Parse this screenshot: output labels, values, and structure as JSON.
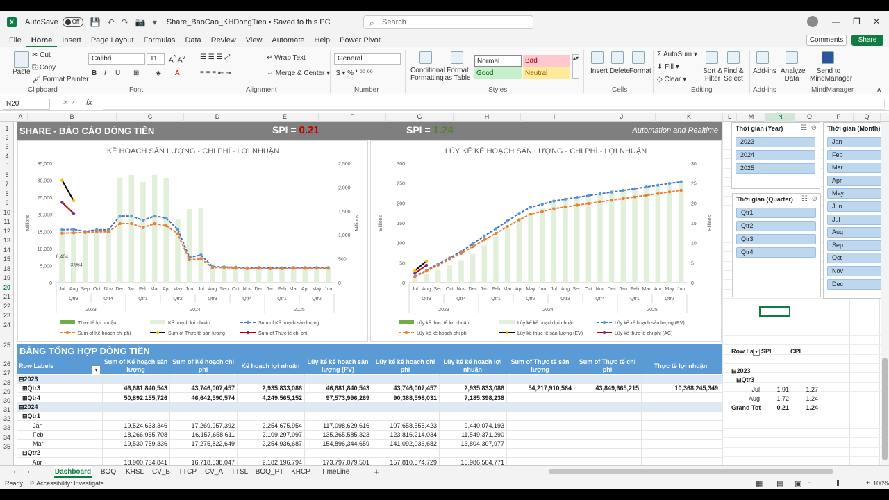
{
  "titlebar": {
    "autosave_label": "AutoSave",
    "autosave_state": "Off",
    "filename": "Share_BaoCao_KHDongTien • Saved to this PC",
    "search_placeholder": "Search"
  },
  "menu": [
    "File",
    "Home",
    "Insert",
    "Page Layout",
    "Formulas",
    "Data",
    "Review",
    "View",
    "Automate",
    "Help",
    "Power Pivot"
  ],
  "menu_active": "Home",
  "comments_label": "Comments",
  "share_label": "Share",
  "ribbon": {
    "clipboard": {
      "paste": "Paste",
      "cut": "Cut",
      "copy": "Copy",
      "format_painter": "Format Painter",
      "group": "Clipboard"
    },
    "font": {
      "name": "Calibri",
      "size": "11",
      "group": "Font"
    },
    "alignment": {
      "wrap": "Wrap Text",
      "merge": "Merge & Center",
      "group": "Alignment"
    },
    "number": {
      "format": "General",
      "group": "Number"
    },
    "styles": {
      "cond": "Conditional Formatting",
      "table": "Format as Table",
      "normal": "Normal",
      "bad": "Bad",
      "good": "Good",
      "neutral": "Neutral",
      "group": "Styles"
    },
    "cells": {
      "insert": "Insert",
      "delete": "Delete",
      "format": "Format",
      "group": "Cells"
    },
    "editing": {
      "autosum": "AutoSum",
      "fill": "Fill",
      "clear": "Clear",
      "sort": "Sort & Filter",
      "find": "Find & Select",
      "group": "Editing"
    },
    "addins": {
      "label": "Add-ins",
      "group": "Add-ins"
    },
    "analyze": "Analyze Data",
    "mindmanager": {
      "label": "Send to MindManager",
      "group": "MindManager"
    }
  },
  "formula_bar": {
    "name_box": "N20",
    "fx": "fx",
    "content": ""
  },
  "columns": [
    "A",
    "B",
    "C",
    "D",
    "E",
    "F",
    "G",
    "H",
    "I",
    "J",
    "K",
    "L",
    "M",
    "N",
    "O",
    "P",
    "Q"
  ],
  "rows": [
    "1",
    "2",
    "3",
    "4",
    "5",
    "6",
    "7",
    "8",
    "9",
    "10",
    "11",
    "12",
    "13",
    "14",
    "15",
    "18",
    "19",
    "20",
    "21",
    "22",
    "23",
    "24",
    "25",
    "26",
    "27",
    "28",
    "29",
    "30",
    "31",
    "32",
    "33",
    "34",
    "35"
  ],
  "banner": {
    "title": "SHARE - BÁO CÁO DÒNG TIỀN",
    "spi1_label": "SPI =",
    "spi1_value": "0.21",
    "spi2_label": "SPI =",
    "spi2_value": "1.24",
    "tagline": "Automation and Realtime"
  },
  "colors": {
    "bad": "#c00000",
    "good": "#548235",
    "header_blue": "#5b9bd5",
    "bar_green": "#70ad47",
    "bar_light": "#e2efda",
    "plan_line": "#4472c4",
    "cost_line": "#ed7d31",
    "actual_line": "#ffc000"
  },
  "chart_data": [
    {
      "type": "bar",
      "title": "KẾ HOẠCH SẢN LƯỢNG - CHI PHÍ - LỢI NHUẬN",
      "ylabel": "Millions",
      "y2label": "Millions",
      "ylim": [
        0,
        35000
      ],
      "y2lim": [
        0,
        2500
      ],
      "yticks": [
        "0",
        "5,000",
        "10,000",
        "15,000",
        "20,000",
        "25,000",
        "30,000",
        "35,000"
      ],
      "y2ticks": [
        "0",
        "500",
        "1,000",
        "1,500",
        "2,000",
        "2,500"
      ],
      "categories": [
        "Jul",
        "Aug",
        "Sep",
        "Oct",
        "Nov",
        "Dec",
        "Jan",
        "Feb",
        "Mar",
        "Apr",
        "May",
        "Jun",
        "Jul",
        "Aug",
        "Sep",
        "Oct",
        "Nov",
        "Dec",
        "Jan",
        "Feb",
        "Mar",
        "Apr",
        "May",
        "Jun"
      ],
      "quarters": [
        "Qtr3",
        "Qtr4",
        "Qtr1",
        "Qtr2",
        "Qtr3",
        "Qtr4",
        "Qtr1",
        "Qtr2"
      ],
      "years": [
        "2023",
        "2024",
        "2025"
      ],
      "data_labels": [
        "6,404",
        "3,964"
      ],
      "series": [
        {
          "name": "Thực tế lợi nhuận",
          "kind": "bar",
          "axis": "y",
          "values": [
            6404,
            3964,
            null,
            null,
            null,
            null,
            null,
            null,
            null,
            null,
            null,
            null,
            null,
            null,
            null,
            null,
            null,
            null,
            null,
            null,
            null,
            null,
            null,
            null
          ]
        },
        {
          "name": "Kế hoạch lợi nhuận",
          "kind": "bar",
          "axis": "y2",
          "values": [
            1080,
            1080,
            1040,
            1110,
            1120,
            2190,
            2254,
            2109,
            2254,
            2182,
            1320,
            1540,
            1570,
            400,
            340,
            330,
            340,
            330,
            320,
            320,
            330,
            330,
            330,
            320
          ]
        },
        {
          "name": "Sum of Kế hoạch sản lượng",
          "kind": "line",
          "axis": "y",
          "values": [
            15500,
            15600,
            15000,
            15500,
            15500,
            19500,
            19524,
            18267,
            19531,
            18900,
            15600,
            7400,
            8100,
            4700,
            4600,
            4500,
            4300,
            4400,
            4300,
            4300,
            4400,
            4400,
            4400,
            4400
          ]
        },
        {
          "name": "Sum of Kế hoạch chi phí",
          "kind": "line",
          "axis": "y",
          "values": [
            14500,
            14600,
            14700,
            14900,
            14900,
            17300,
            17270,
            16158,
            17276,
            16700,
            14300,
            6700,
            7000,
            4400,
            4400,
            4200,
            4100,
            4200,
            4100,
            4100,
            4200,
            4200,
            4200,
            4200
          ]
        },
        {
          "name": "Sum of Thực tế sản lượng",
          "kind": "line",
          "axis": "y",
          "values": [
            30000,
            24000,
            null,
            null,
            null,
            null,
            null,
            null,
            null,
            null,
            null,
            null,
            null,
            null,
            null,
            null,
            null,
            null,
            null,
            null,
            null,
            null,
            null,
            null
          ]
        },
        {
          "name": "Sum of Thực tế chi phí",
          "kind": "line",
          "axis": "y",
          "values": [
            23500,
            20300,
            null,
            null,
            null,
            null,
            null,
            null,
            null,
            null,
            null,
            null,
            null,
            null,
            null,
            null,
            null,
            null,
            null,
            null,
            null,
            null,
            null,
            null
          ]
        }
      ]
    },
    {
      "type": "bar",
      "title": "LŨY KẾ KẾ HOẠCH SẢN LƯỢNG - CHI PHÍ - LỢI NHUẬN",
      "ylabel": "Billions",
      "y2label": "Billions",
      "ylim": [
        0,
        300
      ],
      "y2lim": [
        0,
        30
      ],
      "yticks": [
        "0",
        "50",
        "100",
        "150",
        "200",
        "250",
        "300"
      ],
      "y2ticks": [
        "0",
        "5",
        "10",
        "15",
        "20",
        "25",
        "30"
      ],
      "categories": [
        "Jul",
        "Aug",
        "Sep",
        "Oct",
        "Nov",
        "Dec",
        "Jan",
        "Feb",
        "Mar",
        "Apr",
        "May",
        "Jun",
        "Jul",
        "Aug",
        "Sep",
        "Oct",
        "Nov",
        "Dec",
        "Jan",
        "Feb",
        "Mar",
        "Apr",
        "May",
        "Jun"
      ],
      "quarters": [
        "Qtr3",
        "Qtr4",
        "Qtr1",
        "Qtr2",
        "Qtr3",
        "Qtr4",
        "Qtr1",
        "Qtr2"
      ],
      "years": [
        "2023",
        "2024",
        "2025"
      ],
      "series": [
        {
          "name": "Lũy kế thực tế lợi nhuận",
          "kind": "bar",
          "axis": "y2",
          "values": [
            0.6,
            1.0,
            null,
            null,
            null,
            null,
            null,
            null,
            null,
            null,
            null,
            null,
            null,
            null,
            null,
            null,
            null,
            null,
            null,
            null,
            null,
            null,
            null,
            null
          ]
        },
        {
          "name": "Lũy kế kế hoạch lợi nhuận",
          "kind": "bar",
          "axis": "y2",
          "values": [
            1.1,
            2.2,
            3.2,
            4.3,
            5.5,
            7.2,
            9.4,
            11.5,
            13.8,
            16.0,
            17.3,
            18.8,
            20.4,
            21.0,
            21.4,
            21.8,
            22.2,
            22.6,
            23.0,
            23.4,
            23.8,
            24.2,
            24.6,
            25.0
          ]
        },
        {
          "name": "Lũy kế kế hoạch sản lượng (PV)",
          "kind": "line",
          "axis": "y",
          "values": [
            15.6,
            31.1,
            46.7,
            62.2,
            77.7,
            97.6,
            117.1,
            135.4,
            154.9,
            173.8,
            189.4,
            196.8,
            204.9,
            209.6,
            214.2,
            218.7,
            223.0,
            227.4,
            231.7,
            236.0,
            240.4,
            244.8,
            249.2,
            253.6
          ]
        },
        {
          "name": "Lũy kế kế hoạch chi phí",
          "kind": "line",
          "axis": "y",
          "values": [
            14.6,
            29.2,
            43.7,
            58.6,
            73.5,
            90.4,
            107.7,
            123.8,
            141.1,
            157.8,
            172.1,
            178.8,
            185.8,
            190.2,
            194.6,
            198.8,
            202.9,
            207.1,
            211.2,
            215.3,
            219.5,
            223.7,
            227.9,
            232.1
          ]
        },
        {
          "name": "Lũy kế thực tế sản lượng (EV)",
          "kind": "line",
          "axis": "y",
          "values": [
            30.0,
            54.2,
            null,
            null,
            null,
            null,
            null,
            null,
            null,
            null,
            null,
            null,
            null,
            null,
            null,
            null,
            null,
            null,
            null,
            null,
            null,
            null,
            null,
            null
          ]
        },
        {
          "name": "Lũy kế thực tế chi phí (AC)",
          "kind": "line",
          "axis": "y",
          "values": [
            23.5,
            43.8,
            null,
            null,
            null,
            null,
            null,
            null,
            null,
            null,
            null,
            null,
            null,
            null,
            null,
            null,
            null,
            null,
            null,
            null,
            null,
            null,
            null,
            null
          ]
        }
      ]
    }
  ],
  "slicers": {
    "year": {
      "title": "Thời gian (Year)",
      "items": [
        "2023",
        "2024",
        "2025"
      ]
    },
    "quarter": {
      "title": "Thời gian (Quarter)",
      "items": [
        "Qtr1",
        "Qtr2",
        "Qtr3",
        "Qtr4"
      ]
    },
    "month": {
      "title": "Thời gian (Month)",
      "items": [
        "Jan",
        "Feb",
        "Mar",
        "Apr",
        "May",
        "Jun",
        "Jul",
        "Aug",
        "Sep",
        "Oct",
        "Nov",
        "Dec"
      ]
    }
  },
  "pivot": {
    "title": "BẢNG TỔNG HỢP DÒNG TIỀN",
    "headers": [
      "Row Labels",
      "Sum of Kế hoạch sản lượng",
      "Sum of Kế hoạch chi phí",
      "Kế hoạch lợi nhuận",
      "Lũy kế kế hoạch sản lượng (PV)",
      "Lũy kế kế hoạch chi phí",
      "Lũy kế kế hoạch lợi nhuận",
      "Sum of Thực tế sản lượng",
      "Sum of Thực tế chi phí",
      "Thực tế lợi nhuận"
    ],
    "rows": [
      {
        "label": "⊟2023",
        "cls": "yr",
        "cells": [
          "",
          "",
          "",
          "",
          "",
          "",
          "",
          "",
          ""
        ]
      },
      {
        "label": "  ⊞Qtr3",
        "cls": "bold",
        "cells": [
          "46,681,840,543",
          "43,746,007,457",
          "2,935,833,086",
          "46,681,840,543",
          "43,746,007,457",
          "2,935,833,086",
          "54,217,910,564",
          "43,849,665,215",
          "10,368,245,349"
        ]
      },
      {
        "label": "  ⊞Qtr4",
        "cls": "bold",
        "cells": [
          "50,892,155,726",
          "46,642,590,574",
          "4,249,565,152",
          "97,573,996,269",
          "90,388,598,031",
          "7,185,398,238",
          "",
          "",
          ""
        ]
      },
      {
        "label": "⊟2024",
        "cls": "yr",
        "cells": [
          "",
          "",
          "",
          "",
          "",
          "",
          "",
          "",
          ""
        ]
      },
      {
        "label": "  ⊟Qtr1",
        "cls": "bold",
        "cells": [
          "",
          "",
          "",
          "",
          "",
          "",
          "",
          "",
          ""
        ]
      },
      {
        "label": "        Jan",
        "cls": "",
        "cells": [
          "19,524,633,346",
          "17,269,957,392",
          "2,254,675,954",
          "117,098,629,616",
          "107,658,555,423",
          "9,440,074,193",
          "",
          "",
          ""
        ]
      },
      {
        "label": "        Feb",
        "cls": "",
        "cells": [
          "18,266,955,708",
          "16,157,658,611",
          "2,109,297,097",
          "135,365,585,323",
          "123,816,214,034",
          "11,549,371,290",
          "",
          "",
          ""
        ]
      },
      {
        "label": "        Mar",
        "cls": "",
        "cells": [
          "19,530,759,336",
          "17,275,822,649",
          "2,254,936,687",
          "154,896,344,659",
          "141,092,036,682",
          "13,804,307,977",
          "",
          "",
          ""
        ]
      },
      {
        "label": "  ⊟Qtr2",
        "cls": "bold",
        "cells": [
          "",
          "",
          "",
          "",
          "",
          "",
          "",
          "",
          ""
        ]
      },
      {
        "label": "        Apr",
        "cls": "",
        "cells": [
          "18,900,734,841",
          "16,718,538,047",
          "2,182,196,794",
          "173,797,079,501",
          "157,810,574,729",
          "15,986,504,771",
          "",
          "",
          ""
        ]
      }
    ]
  },
  "small_pivot": {
    "headers": [
      "Row La",
      "SPI",
      "CPI"
    ],
    "rows": [
      {
        "label": "⊟2023",
        "spi": "",
        "cpi": ""
      },
      {
        "label": "⊟Qtr3",
        "spi": "",
        "cpi": ""
      },
      {
        "label": "Jul",
        "spi": "1.91",
        "cpi": "1.27"
      },
      {
        "label": "Aug",
        "spi": "1.72",
        "cpi": "1.24"
      },
      {
        "label": "Grand Tot",
        "spi": "0.21",
        "cpi": "1.24"
      }
    ]
  },
  "tabs": [
    "Dashboard",
    "BOQ",
    "KHSL",
    "CV_B",
    "TTCP",
    "CV_A",
    "TTSL",
    "BOQ_PT",
    "KHCP",
    "TimeLine"
  ],
  "active_tab": "Dashboard",
  "status": {
    "ready": "Ready",
    "accessibility": "Accessibility: Investigate",
    "zoom": "100%"
  }
}
